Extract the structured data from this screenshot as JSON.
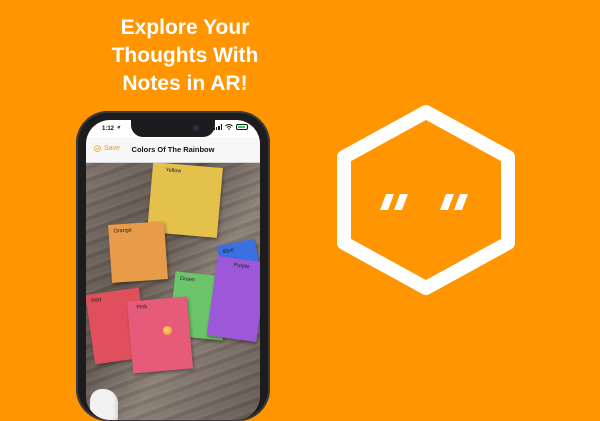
{
  "headline": {
    "line1": "Explore Your",
    "line2": "Thoughts With",
    "line3": "Notes in AR!"
  },
  "status_bar": {
    "time": "1:12",
    "location_icon": "location-arrow-icon",
    "signal_icon": "cellular-signal-icon",
    "wifi_icon": "wifi-icon",
    "battery_icon": "battery-icon"
  },
  "nav_bar": {
    "save_label": "Save",
    "save_icon": "save-check-icon",
    "title": "Colors Of The Rainbow"
  },
  "notes": [
    {
      "label": "Yellow",
      "color": "#e3c14b"
    },
    {
      "label": "Orange",
      "color": "#e89b48"
    },
    {
      "label": "Blue",
      "color": "#3c6fe0"
    },
    {
      "label": "Green",
      "color": "#6cc46a"
    },
    {
      "label": "Purple",
      "color": "#9c58d8"
    },
    {
      "label": "Red",
      "color": "#e0505c"
    },
    {
      "label": "Pink",
      "color": "#e65a7a"
    }
  ],
  "logo": {
    "icon": "quote-hexagon-icon",
    "color": "#ffffff"
  },
  "colors": {
    "background": "#ff9500",
    "accent": "#ff9500"
  }
}
